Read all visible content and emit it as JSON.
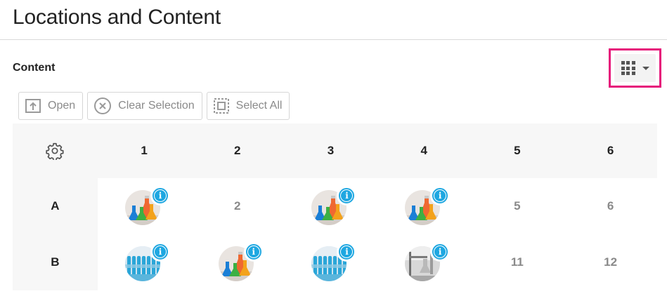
{
  "page": {
    "title": "Locations and Content"
  },
  "content": {
    "label": "Content"
  },
  "view_toggle": {
    "icon": "grid-view-icon",
    "caret_icon": "caret-down-icon",
    "highlight_color": "#e6157a"
  },
  "toolbar": {
    "open_label": "Open",
    "clear_label": "Clear Selection",
    "select_all_label": "Select All"
  },
  "grid": {
    "settings_icon": "gear-icon",
    "columns": [
      "1",
      "2",
      "3",
      "4",
      "5",
      "6"
    ],
    "rows": [
      {
        "label": "A",
        "cells": [
          {
            "type": "sample",
            "image": "flasks",
            "position": "1"
          },
          {
            "type": "empty",
            "position": "2"
          },
          {
            "type": "sample",
            "image": "flasks",
            "position": "3"
          },
          {
            "type": "sample",
            "image": "flasks",
            "position": "4"
          },
          {
            "type": "empty",
            "position": "5"
          },
          {
            "type": "empty",
            "position": "6"
          }
        ]
      },
      {
        "label": "B",
        "cells": [
          {
            "type": "sample",
            "image": "test-tubes",
            "position": "7"
          },
          {
            "type": "sample",
            "image": "flasks",
            "position": "8"
          },
          {
            "type": "sample",
            "image": "test-tubes",
            "position": "9"
          },
          {
            "type": "sample",
            "image": "lab-equipment",
            "position": "10"
          },
          {
            "type": "empty",
            "position": "11"
          },
          {
            "type": "empty",
            "position": "12"
          }
        ]
      }
    ]
  },
  "colors": {
    "info_badge": "#1ea7e1",
    "header_bg": "#f7f7f7",
    "muted_text": "#8a8a8a"
  }
}
